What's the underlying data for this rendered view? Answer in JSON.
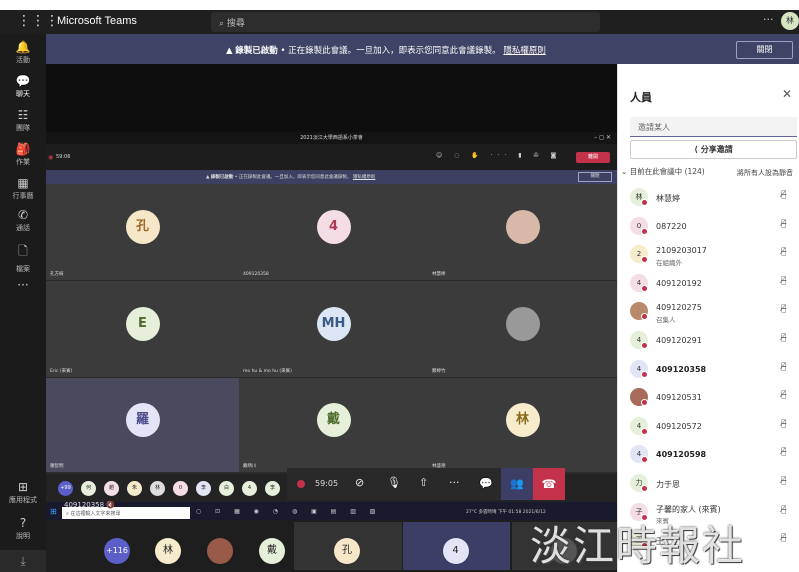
{
  "app": {
    "name": "Microsoft Teams",
    "search_placeholder": "搜尋",
    "more": "···",
    "avatar": "林"
  },
  "rail": [
    {
      "label": "活動",
      "icon": "bell-icon",
      "glyph": "🔔"
    },
    {
      "label": "聊天",
      "icon": "chat-icon",
      "glyph": "💬",
      "active": true
    },
    {
      "label": "團隊",
      "icon": "teams-icon",
      "glyph": "☷"
    },
    {
      "label": "作業",
      "icon": "assignments-icon",
      "glyph": "🎒"
    },
    {
      "label": "行事曆",
      "icon": "calendar-icon",
      "glyph": "▦"
    },
    {
      "label": "通話",
      "icon": "phone-icon",
      "glyph": "✆"
    },
    {
      "label": "檔案",
      "icon": "file-icon",
      "glyph": "🗋"
    },
    {
      "label": "",
      "icon": "more-apps-icon",
      "glyph": "···"
    },
    {
      "label": "應用程式",
      "icon": "apps-icon",
      "glyph": "⊞"
    },
    {
      "label": "說明",
      "icon": "help-icon",
      "glyph": "?"
    }
  ],
  "banner": {
    "title": "錄製已啟動",
    "text": "• 正在錄製此會議。一旦加入，即表示您同意此會議錄製。",
    "link": "隱私權原則",
    "dismiss": "關閉"
  },
  "shared_window": {
    "title": "2021淡江大學西語系小茶會",
    "controls": "–   ◻   ✕",
    "time": "59:06",
    "leave": "離開",
    "banner_title": "錄製已啟動",
    "banner_text": "• 正在錄製此會議。一旦加入，即表示您同意此會議錄製。",
    "banner_link": "隱私權原則",
    "banner_dismiss": "關閉",
    "tiles": [
      {
        "avatar": "孔",
        "name": "孔方綺",
        "color": "#f6e7c8",
        "textColor": "#a0682a"
      },
      {
        "avatar": "4",
        "name": "409120358",
        "color": "#f4dde4",
        "textColor": "#b03a55"
      },
      {
        "avatar": "",
        "name": "林慧婷",
        "color": "#d8b8a8",
        "textColor": "#333"
      },
      {
        "avatar": "E",
        "name": "Eric (來賓)",
        "color": "#e6efd9",
        "textColor": "#4d6b2a"
      },
      {
        "avatar": "MH",
        "name": "mo hu & mo hu (來賓)",
        "color": "#dce6f4",
        "textColor": "#3b5a88"
      },
      {
        "avatar": "",
        "name": "鄭婷竹",
        "color": "#999",
        "textColor": "#333"
      },
      {
        "avatar": "羅",
        "name": "羅智明",
        "color": "#e3e4f6",
        "textColor": "#4a4c8c"
      },
      {
        "avatar": "戴",
        "name": "戴晴川",
        "color": "#e6efd9",
        "textColor": "#4d6b2a"
      },
      {
        "avatar": "林",
        "name": "林盛德",
        "color": "#f6eccb",
        "textColor": "#8a6a1a"
      }
    ],
    "strip": [
      "+99",
      "何",
      "趙",
      "朱",
      "林",
      "0",
      "李",
      "白",
      "4",
      "李",
      "4",
      "",
      "4",
      "4",
      "張",
      "楊",
      "4"
    ],
    "taskbar_search": "在這裡輸入文字來搜尋",
    "tray": "27°C 多雲時晴   下午 01:58   2021/6/12"
  },
  "controls": {
    "timer": "59:05"
  },
  "self_name": "409120358",
  "bottom": {
    "overflow": "+116",
    "chips": [
      "林",
      "",
      "戴"
    ],
    "tiles": [
      "孔",
      "4",
      ""
    ]
  },
  "panel": {
    "title": "人員",
    "invite_placeholder": "邀請某人",
    "share": "分享邀請",
    "in_meeting": "目前在此會議中 (124)",
    "mute_all": "將所有人設為靜音",
    "people": [
      {
        "name": "林慧婷",
        "avatar": "林",
        "bg": "#e6efd9",
        "bold": false
      },
      {
        "name": "087220",
        "avatar": "0",
        "bg": "#f4dde4",
        "bold": false
      },
      {
        "name": "2109203017",
        "sub": "在組織外",
        "avatar": "2",
        "bg": "#f6eccb",
        "bold": false
      },
      {
        "name": "409120192",
        "avatar": "4",
        "bg": "#f4dde4",
        "bold": false
      },
      {
        "name": "409120275",
        "sub": "召集人",
        "avatar": "",
        "bg": "#b98a6a",
        "bold": false
      },
      {
        "name": "409120291",
        "avatar": "4",
        "bg": "#e6efd9",
        "bold": false
      },
      {
        "name": "409120358",
        "avatar": "4",
        "bg": "#e3e4f6",
        "bold": true
      },
      {
        "name": "409120531",
        "avatar": "",
        "bg": "#a86a5a",
        "bold": false
      },
      {
        "name": "409120572",
        "avatar": "4",
        "bg": "#e6efd9",
        "bold": false
      },
      {
        "name": "409120598",
        "avatar": "4",
        "bg": "#e3e4f6",
        "bold": true
      },
      {
        "name": "力于恩",
        "avatar": "力",
        "bg": "#e6efd9",
        "bold": false
      },
      {
        "name": "子馨的家人 (來賓)",
        "sub": "來賓",
        "avatar": "子",
        "bg": "#f4dde4",
        "bold": false
      },
      {
        "name": "王",
        "avatar": "王",
        "bg": "#e6efd9",
        "bold": false
      }
    ]
  },
  "watermark": "淡江時報社"
}
